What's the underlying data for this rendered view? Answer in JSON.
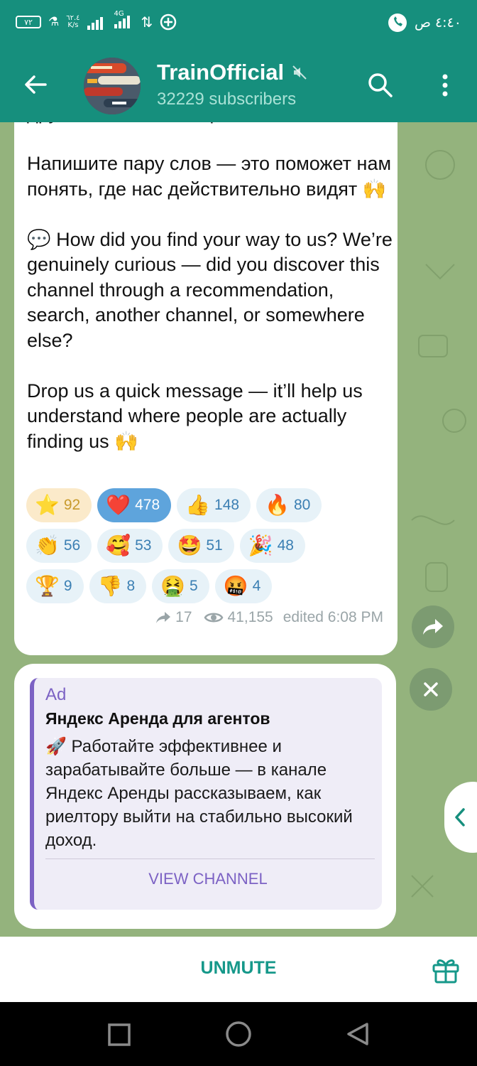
{
  "status_bar": {
    "battery": "٧٢",
    "network_speed": "٦٢.٤",
    "speed_unit": "K/s",
    "network_type": "4G",
    "time": "٤:٤٠ ص"
  },
  "header": {
    "channel_name": "TrainOfficial",
    "subscribers": "32229 subscribers"
  },
  "message": {
    "text": "другой канал или ещё как-то?\n\nНапишите пару слов — это поможет нам понять, где нас действительно видят 🙌\n\n💬 How did you find your way to us? We’re genuinely curious — did you discover this channel through a recommendation, search, another channel, or somewhere else?\n\nDrop us a quick message — it’ll help us understand where people are actually finding us 🙌",
    "reactions": [
      {
        "emoji": "⭐",
        "count": "92",
        "style": "gold"
      },
      {
        "emoji": "❤️",
        "count": "478",
        "style": "active"
      },
      {
        "emoji": "👍",
        "count": "148",
        "style": "normal"
      },
      {
        "emoji": "🔥",
        "count": "80",
        "style": "normal"
      },
      {
        "emoji": "👏",
        "count": "56",
        "style": "normal"
      },
      {
        "emoji": "🥰",
        "count": "53",
        "style": "normal"
      },
      {
        "emoji": "🤩",
        "count": "51",
        "style": "normal"
      },
      {
        "emoji": "🎉",
        "count": "48",
        "style": "normal"
      },
      {
        "emoji": "🏆",
        "count": "9",
        "style": "normal"
      },
      {
        "emoji": "👎",
        "count": "8",
        "style": "normal"
      },
      {
        "emoji": "🤮",
        "count": "5",
        "style": "normal"
      },
      {
        "emoji": "🤬",
        "count": "4",
        "style": "normal"
      }
    ],
    "forwards": "17",
    "views": "41,155",
    "edited": "edited 6:08 PM"
  },
  "ad": {
    "label": "Ad",
    "title": "Яндекс Аренда для агентов",
    "text": "🚀 Работайте эффективнее и зарабатывайте больше — в канале Яндекс Аренды рассказываем, как риелтору выйти на стабильно высокий доход.",
    "button": "VIEW CHANNEL"
  },
  "bottom": {
    "unmute_label": "UNMUTE"
  },
  "colors": {
    "header": "#168f7d",
    "accent_purple": "#7c62c4",
    "reaction_blue": "#5ea4dc",
    "unmute": "#16988a"
  }
}
